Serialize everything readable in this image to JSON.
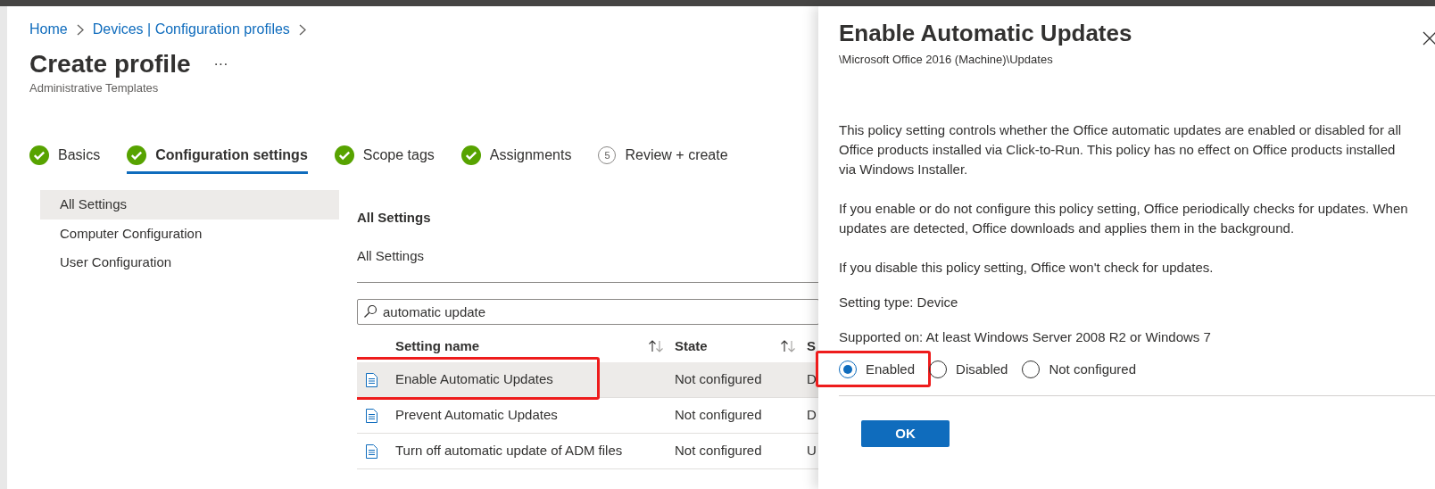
{
  "breadcrumb": [
    {
      "label": "Home"
    },
    {
      "label": "Devices | Configuration profiles"
    }
  ],
  "page": {
    "title": "Create profile",
    "more": "···",
    "subtitle": "Administrative Templates"
  },
  "wizard_tabs": [
    {
      "label": "Basics",
      "kind": "done",
      "selected": false
    },
    {
      "label": "Configuration settings",
      "kind": "done",
      "selected": true
    },
    {
      "label": "Scope tags",
      "kind": "done",
      "selected": false
    },
    {
      "label": "Assignments",
      "kind": "done",
      "selected": false
    },
    {
      "label": "Review + create",
      "kind": "step",
      "number": "5",
      "selected": false
    }
  ],
  "nav": [
    {
      "label": "All Settings",
      "selected": true
    },
    {
      "label": "Computer Configuration",
      "selected": false
    },
    {
      "label": "User Configuration",
      "selected": false
    }
  ],
  "section": {
    "title": "All Settings",
    "path": "All Settings"
  },
  "search": {
    "value": "automatic update"
  },
  "table": {
    "columns": [
      {
        "label": "Setting name",
        "sortable": true
      },
      {
        "label": "State",
        "sortable": true
      },
      {
        "label": "S",
        "sortable": false
      }
    ],
    "rows": [
      {
        "cells": [
          "Enable Automatic Updates",
          "Not configured",
          "D"
        ],
        "selected": true,
        "annotated": true
      },
      {
        "cells": [
          "Prevent Automatic Updates",
          "Not configured",
          "D"
        ],
        "selected": false,
        "annotated": false
      },
      {
        "cells": [
          "Turn off automatic update of ADM files",
          "Not configured",
          "U"
        ],
        "selected": false,
        "annotated": false
      }
    ]
  },
  "panel": {
    "title": "Enable Automatic Updates",
    "path": "\\Microsoft Office 2016 (Machine)\\Updates",
    "paragraphs": [
      "This policy setting controls whether the Office automatic updates are enabled or disabled for all Office products installed via Click-to-Run. This policy has no effect on Office products installed via Windows Installer.",
      "If you enable or do not configure this policy setting, Office periodically checks for updates. When updates are detected, Office downloads and applies them in the background.",
      "If you disable this policy setting, Office won't check for updates.",
      "Setting type: Device",
      "Supported on: At least Windows Server 2008 R2 or Windows 7"
    ],
    "options": [
      {
        "label": "Enabled",
        "selected": true,
        "annotated": true
      },
      {
        "label": "Disabled",
        "selected": false,
        "annotated": false
      },
      {
        "label": "Not configured",
        "selected": false,
        "annotated": false
      }
    ],
    "ok": "OK"
  }
}
